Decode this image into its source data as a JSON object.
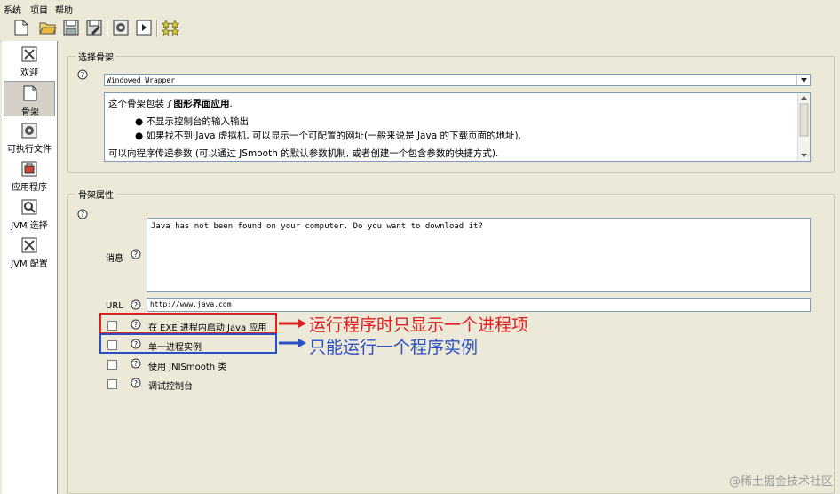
{
  "menu": {
    "items": [
      "系统",
      "项目",
      "帮助"
    ]
  },
  "toolbar": {
    "icons": [
      "new-file-icon",
      "open-folder-icon",
      "save-icon",
      "save-as-icon",
      "compile-icon",
      "run-icon",
      "wizard-icon"
    ]
  },
  "sidebar": {
    "items": [
      {
        "label": "欢迎",
        "icon": "welcome-icon",
        "selected": false
      },
      {
        "label": "骨架",
        "icon": "skeleton-icon",
        "selected": true
      },
      {
        "label": "可执行文件",
        "icon": "executable-icon",
        "selected": false
      },
      {
        "label": "应用程序",
        "icon": "application-icon",
        "selected": false
      },
      {
        "label": "JVM 选择",
        "icon": "jvm-select-icon",
        "selected": false
      },
      {
        "label": "JVM 配置",
        "icon": "jvm-config-icon",
        "selected": false
      }
    ]
  },
  "skeleton_select": {
    "title": "选择骨架",
    "combo_value": "Windowed Wrapper",
    "desc_line1_prefix": "这个骨架包装了",
    "desc_line1_bold": "图形界面应用",
    "desc_line1_suffix": ".",
    "bullet1": "不显示控制台的输入输出",
    "bullet2": "如果找不到 Java 虚拟机, 可以显示一个可配置的网址(一般来说是 Java 的下载页面的地址).",
    "desc_line_last": "可以向程序传递参数 (可以通过 JSmooth 的默认参数机制, 或者创建一个包含参数的快捷方式)."
  },
  "skeleton_props": {
    "title": "骨架属性",
    "message_label": "消息",
    "message_value": "Java has not been found on your computer. Do you want to download it?",
    "url_label": "URL",
    "url_value": "http://www.java.com",
    "checkboxes": [
      {
        "label": "在 EXE 进程内启动 Java 应用",
        "checked": false
      },
      {
        "label": "单一进程实例",
        "checked": false
      },
      {
        "label": "使用 JNISmooth 类",
        "checked": false
      },
      {
        "label": "调试控制台",
        "checked": false
      }
    ]
  },
  "annotations": {
    "red_note": "运行程序时只显示一个进程项",
    "blue_note": "只能运行一个程序实例",
    "red_color": "#e02020",
    "blue_color": "#2a4fc4"
  },
  "watermark": "@稀土掘金技术社区"
}
